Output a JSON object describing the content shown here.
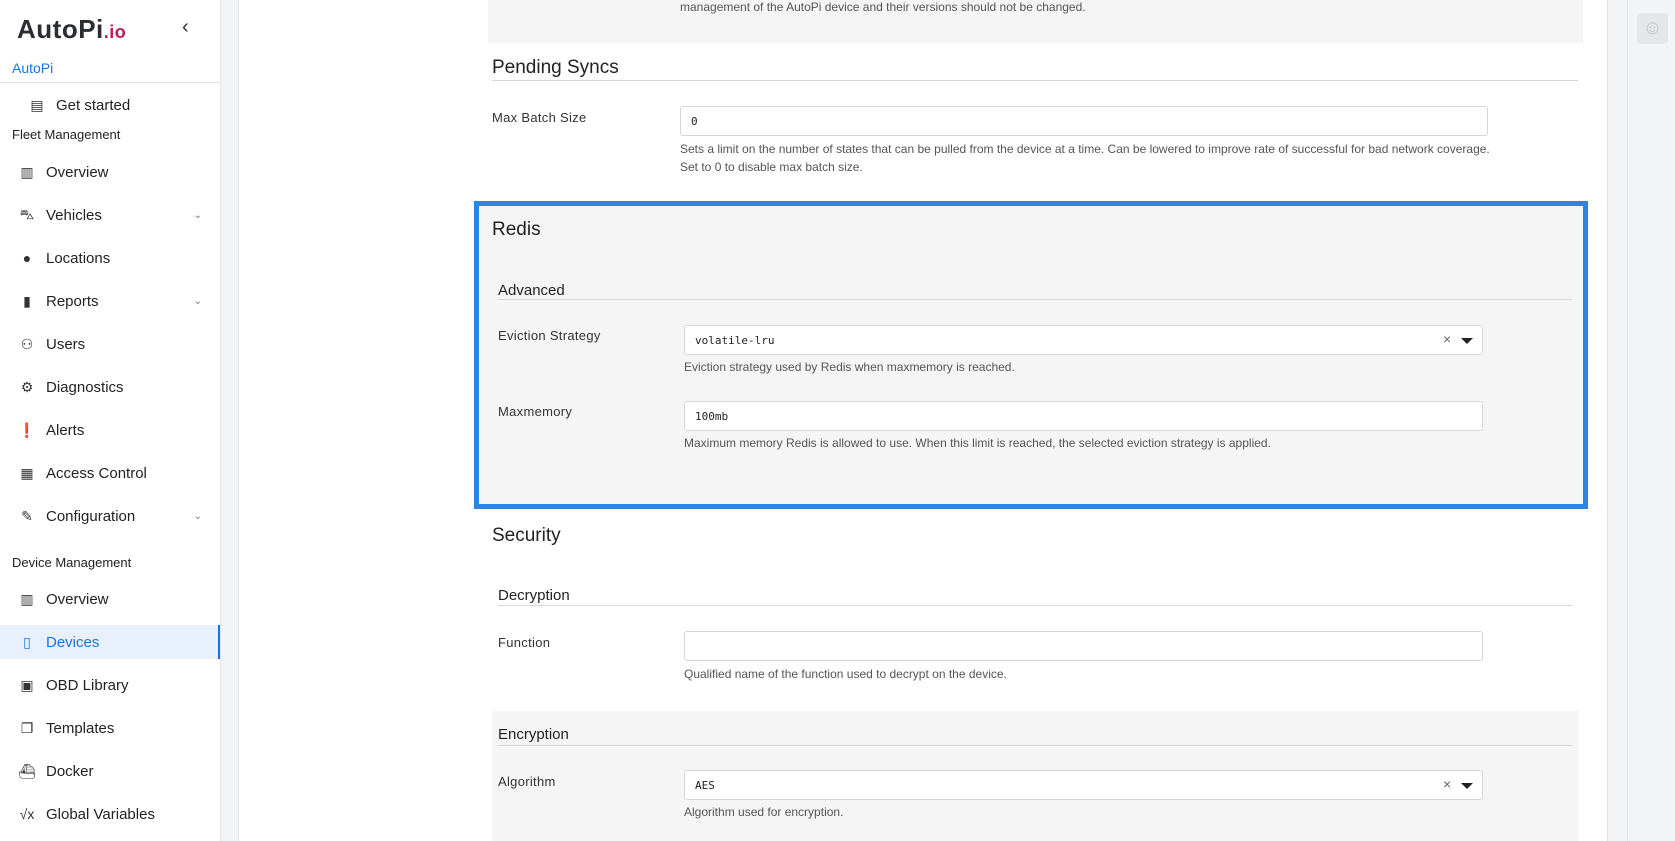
{
  "sidebar": {
    "logo_main": "AutoPi",
    "logo_suffix": ".io",
    "collapse_icon": "chevron-left-icon",
    "org_name": "AutoPi",
    "get_started": "Get started",
    "fleet_heading": "Fleet Management",
    "fleet_items": [
      {
        "label": "Overview",
        "icon": "chart-icon"
      },
      {
        "label": "Vehicles",
        "icon": "car-icon"
      },
      {
        "label": "Locations",
        "icon": "pin-icon"
      },
      {
        "label": "Reports",
        "icon": "document-icon"
      },
      {
        "label": "Users",
        "icon": "users-icon"
      },
      {
        "label": "Diagnostics",
        "icon": "diagnostics-icon"
      },
      {
        "label": "Alerts",
        "icon": "alert-icon"
      },
      {
        "label": "Access Control",
        "icon": "access-icon"
      },
      {
        "label": "Configuration",
        "icon": "wrench-icon"
      }
    ],
    "device_heading": "Device Management",
    "device_items": [
      {
        "label": "Overview",
        "icon": "chart-icon"
      },
      {
        "label": "Devices",
        "icon": "devices-icon"
      },
      {
        "label": "OBD Library",
        "icon": "book-icon"
      },
      {
        "label": "Templates",
        "icon": "templates-icon"
      },
      {
        "label": "Docker",
        "icon": "docker-icon"
      },
      {
        "label": "Global Variables",
        "icon": "sqrt-icon"
      }
    ]
  },
  "content": {
    "top_note": "management of the AutoPi device and their versions should not be changed.",
    "pending_syncs": {
      "title": "Pending Syncs",
      "max_batch_label": "Max Batch Size",
      "max_batch_value": "0",
      "max_batch_help_1": "Sets a limit on the number of states that can be pulled from the device at a time. Can be lowered to improve rate of successful for bad network coverage.",
      "max_batch_help_2": "Set to 0 to disable max batch size."
    },
    "redis": {
      "title": "Redis",
      "advanced": "Advanced",
      "eviction_label": "Eviction Strategy",
      "eviction_value": "volatile-lru",
      "eviction_help": "Eviction strategy used by Redis when maxmemory is reached.",
      "maxmemory_label": "Maxmemory",
      "maxmemory_value": "100mb",
      "maxmemory_help": "Maximum memory Redis is allowed to use. When this limit is reached, the selected eviction strategy is applied.",
      "highlight_color": "#2a85e6"
    },
    "security": {
      "title": "Security",
      "decryption": "Decryption",
      "function_label": "Function",
      "function_value": "",
      "function_help": "Qualified name of the function used to decrypt on the device.",
      "encryption": "Encryption",
      "algorithm_label": "Algorithm",
      "algorithm_value": "AES",
      "algorithm_help": "Algorithm used for encryption."
    }
  },
  "colors": {
    "accent": "#1a73e8",
    "brand": "#c2185b"
  }
}
